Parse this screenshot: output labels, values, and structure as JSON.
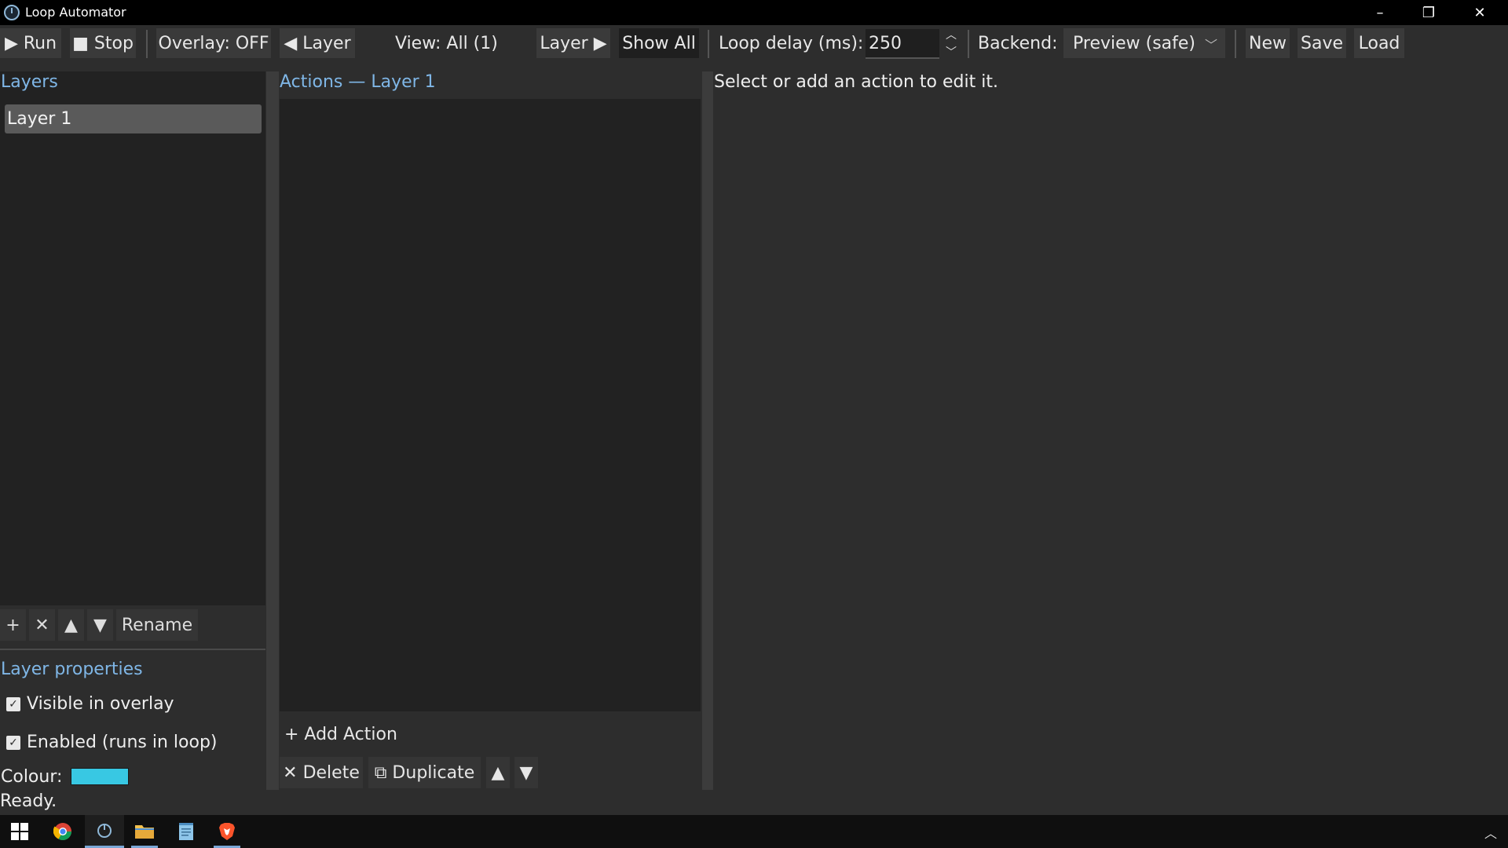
{
  "window": {
    "title": "Loop Automator",
    "minimize": "–",
    "maximize": "❐",
    "close": "✕"
  },
  "toolbar": {
    "run": "▶ Run",
    "stop": "■ Stop",
    "overlay": "Overlay: OFF",
    "prev_layer": "◀ Layer",
    "view": "View: All (1)",
    "next_layer": "Layer ▶",
    "show_all": "Show All",
    "loop_delay_label": "Loop delay (ms):",
    "loop_delay_value": "250",
    "backend_label": "Backend:",
    "backend_value": "Preview (safe)",
    "new": "New",
    "save": "Save",
    "load": "Load"
  },
  "layers": {
    "title": "Layers",
    "items": [
      {
        "label": "Layer 1"
      }
    ],
    "add": "+",
    "remove": "✕",
    "up": "▲",
    "down": "▼",
    "rename": "Rename"
  },
  "layer_properties": {
    "title": "Layer properties",
    "visible": {
      "label": "Visible in overlay",
      "checked": true
    },
    "enabled": {
      "label": "Enabled (runs in loop)",
      "checked": true
    },
    "colour_label": "Colour:",
    "colour_value": "#38c8e3"
  },
  "actions": {
    "title": "Actions — Layer 1",
    "add_action": "+ Add Action",
    "delete": "✕ Delete",
    "duplicate": "⧉ Duplicate",
    "up": "▲",
    "down": "▼"
  },
  "editor": {
    "message": "Select or add an action to edit it."
  },
  "status": {
    "text": "Ready."
  },
  "colors": {
    "accent": "#7fb6e6",
    "selected_layer_bg": "#5a5a5a"
  }
}
